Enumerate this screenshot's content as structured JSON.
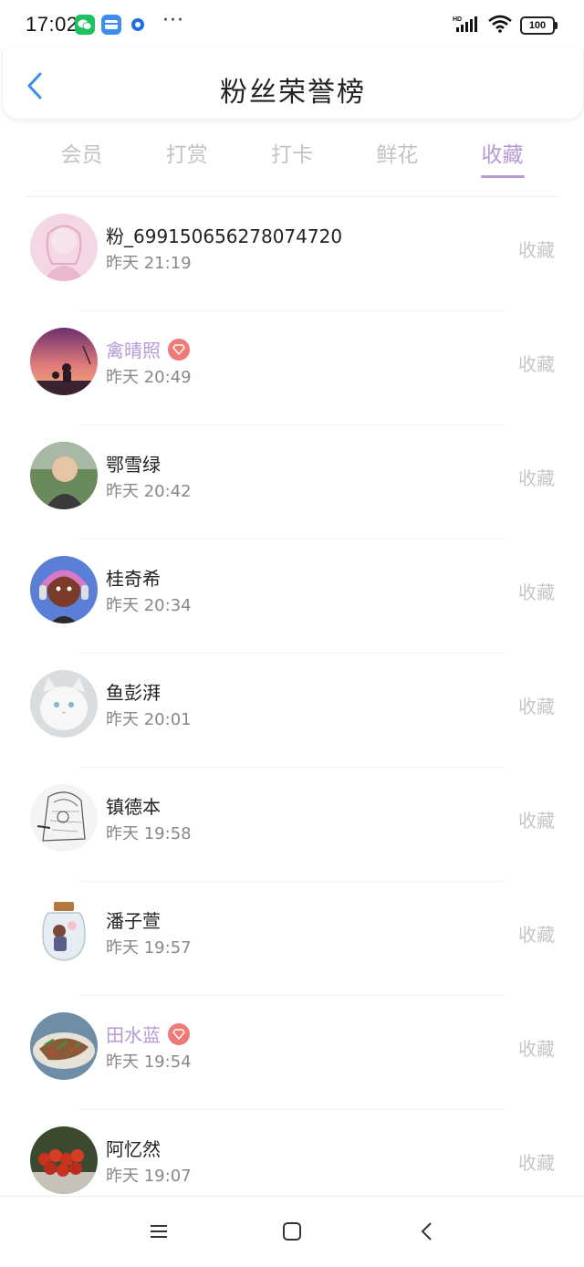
{
  "status_bar": {
    "time": "17:02",
    "more": "···",
    "battery": "100",
    "signal_label": "HD"
  },
  "header": {
    "title": "粉丝荣誉榜"
  },
  "tabs": [
    {
      "label": "会员",
      "active": false
    },
    {
      "label": "打赏",
      "active": false
    },
    {
      "label": "打卡",
      "active": false
    },
    {
      "label": "鲜花",
      "active": false
    },
    {
      "label": "收藏",
      "active": true
    }
  ],
  "fans": [
    {
      "name": "粉_699150656278074720",
      "time": "昨天 21:19",
      "action": "收藏",
      "vip": false
    },
    {
      "name": "禽晴照",
      "time": "昨天 20:49",
      "action": "收藏",
      "vip": true
    },
    {
      "name": "鄂雪绿",
      "time": "昨天 20:42",
      "action": "收藏",
      "vip": false
    },
    {
      "name": "桂奇希",
      "time": "昨天 20:34",
      "action": "收藏",
      "vip": false
    },
    {
      "name": "鱼彭湃",
      "time": "昨天 20:01",
      "action": "收藏",
      "vip": false
    },
    {
      "name": "镇德本",
      "time": "昨天 19:58",
      "action": "收藏",
      "vip": false
    },
    {
      "name": "潘子萱",
      "time": "昨天 19:57",
      "action": "收藏",
      "vip": false
    },
    {
      "name": "田水蓝",
      "time": "昨天 19:54",
      "action": "收藏",
      "vip": true
    },
    {
      "name": "阿忆然",
      "time": "昨天 19:07",
      "action": "收藏",
      "vip": false
    }
  ],
  "colors": {
    "accent": "#b59ad6",
    "vip_badge": "#ee7b78",
    "back_arrow": "#3d8fe8"
  }
}
